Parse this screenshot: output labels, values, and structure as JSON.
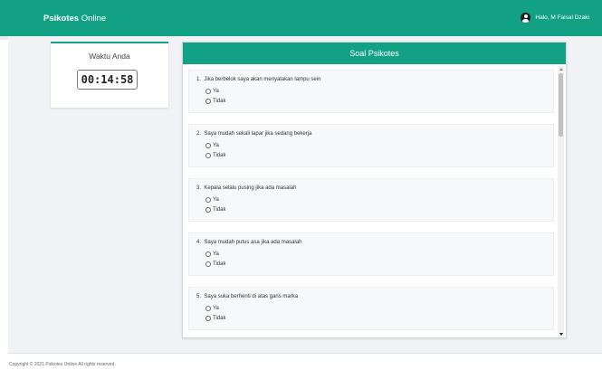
{
  "navbar": {
    "brand_bold": "Psikotes",
    "brand_rest": " Online",
    "greeting": "Halo, M Faisal Dzaki",
    "user_icon": "user-circle-icon",
    "bg_color": "#12a185"
  },
  "timer": {
    "title": "Waktu Anda",
    "value": "00:14:58"
  },
  "soal": {
    "title": "Soal Psikotes",
    "questions": [
      {
        "number": "1.",
        "text": "Jika berbelok saya akan menyalakan lampu sein",
        "options": [
          "Ya",
          "Tidak"
        ]
      },
      {
        "number": "2.",
        "text": "Saya mudah sekali lapar jika sedang bekerja",
        "options": [
          "Ya",
          "Tidak"
        ]
      },
      {
        "number": "3.",
        "text": "Kepala selalu pusing jika ada masalah",
        "options": [
          "Ya",
          "Tidak"
        ]
      },
      {
        "number": "4.",
        "text": "Saya mudah putus asa jika ada masalah",
        "options": [
          "Ya",
          "Tidak"
        ]
      },
      {
        "number": "5.",
        "text": "Saya suka berhenti di atas garis marka",
        "options": [
          "Ya",
          "Tidak"
        ]
      }
    ]
  },
  "footer": {
    "text": "Copyright © 2021 Psikotes Online All rights reserved."
  }
}
